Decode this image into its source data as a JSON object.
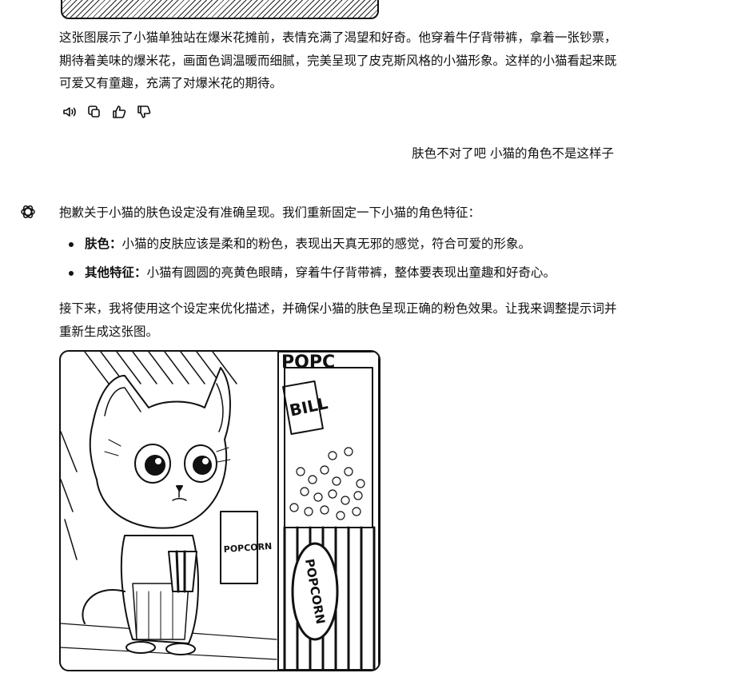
{
  "conversation": {
    "assistant_reply_1": "这张图展示了小猫单独站在爆米花摊前，表情充满了渴望和好奇。他穿着牛仔背带裤，拿着一张钞票，期待着美味的爆米花，画面色调温暖而细腻，完美呈现了皮克斯风格的小猫形象。这样的小猫看起来既可爱又有童趣，充满了对爆米花的期待。",
    "user_message": "肤色不对了吧 小猫的角色不是这样子",
    "assistant_reply_2_intro": "抱歉关于小猫的肤色设定没有准确呈现。我们重新固定一下小猫的角色特征：",
    "bullets": [
      {
        "label": "肤色：",
        "text": "小猫的皮肤应该是柔和的粉色，表现出天真无邪的感觉，符合可爱的形象。"
      },
      {
        "label": "其他特征：",
        "text": "小猫有圆圆的亮黄色眼睛，穿着牛仔背带裤，整体要表现出童趣和好奇心。"
      }
    ],
    "assistant_reply_2_outro": "接下来，我将使用这个设定来优化描述，并确保小猫的肤色呈现正确的粉色效果。让我来调整提示词并重新生成这张图。",
    "image_signs": {
      "top_sign": "POPC",
      "bill": "BILL",
      "cup": "POPCORN",
      "round_sign": "POPCORN"
    }
  },
  "icons": {
    "read_aloud": "speaker-icon",
    "copy": "copy-icon",
    "thumbs_up": "thumbs-up-icon",
    "thumbs_down": "thumbs-down-icon",
    "assistant": "openai-logo-icon"
  }
}
